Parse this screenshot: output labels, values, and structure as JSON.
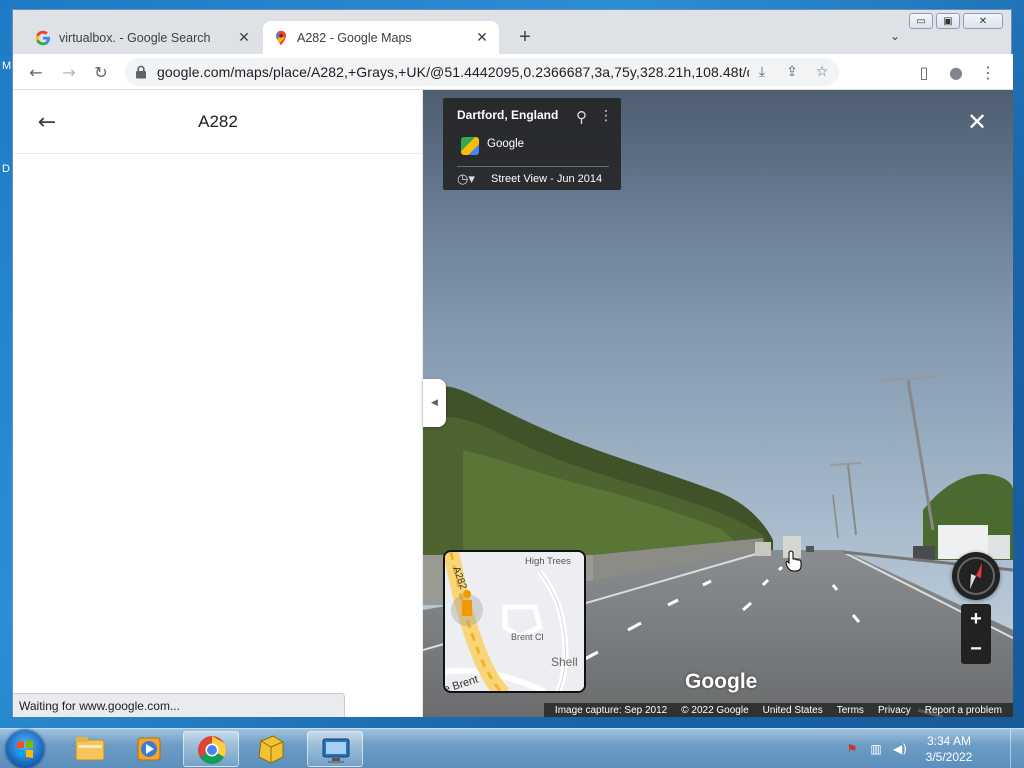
{
  "desktop": {
    "fragments": [
      "M",
      "D"
    ]
  },
  "window": {
    "minimize": "▭",
    "maximize": "▣",
    "close": "✕"
  },
  "tabs": [
    {
      "title": "virtualbox. - Google Search",
      "close": "✕",
      "active": false,
      "favicon": "google-g-icon"
    },
    {
      "title": "A282 - Google Maps",
      "close": "✕",
      "active": true,
      "favicon": "google-maps-pin-icon"
    }
  ],
  "tabstrip": {
    "new_tab": "+",
    "tab_search": "⌄"
  },
  "toolbar": {
    "back": "←",
    "forward": "→",
    "reload": "↻",
    "url": "google.com/maps/place/A282,+Grays,+UK/@51.4442095,0.2366687,3a,75y,328.21h,108.48t/data=!3m...",
    "install": "⤓",
    "share": "⇪",
    "bookmark": "☆",
    "sidepanel": "▯",
    "profile": "●",
    "menu": "⋮"
  },
  "left_panel": {
    "back": "←",
    "title": "A282"
  },
  "status_bar": "Waiting for www.google.com...",
  "collapse_arrow": "◀",
  "street_view": {
    "place": "Dartford, England",
    "provider": "Google",
    "pin": "⚲",
    "more": "⋮",
    "history": "◷▾",
    "date": "Street View - Jun 2014",
    "close": "✕",
    "watermark": "Google",
    "minimap_labels": [
      "A282",
      "High Trees",
      "Brent Cl",
      "Shell",
      "e Brent"
    ],
    "zoom_in": "+",
    "zoom_out": "−",
    "attribution": [
      "Image capture: Sep 2012",
      "© 2022 Google",
      "United States",
      "Terms",
      "Privacy",
      "Report a problem"
    ]
  },
  "taskbar": {
    "items": [
      "windows-explorer-icon",
      "media-player-icon",
      "chrome-icon",
      "virtualbox-icon",
      "remote-desktop-icon"
    ],
    "tray_icons": [
      "action-center-flag-icon",
      "network-icon",
      "volume-icon"
    ],
    "flag": "⚑",
    "network": "▥",
    "volume": "◀)",
    "time": "3:34 AM",
    "date": "3/5/2022"
  },
  "colors": {
    "accent": "#1a73e8",
    "taskbar": "#6e9dc4",
    "infocard": "#222222"
  }
}
